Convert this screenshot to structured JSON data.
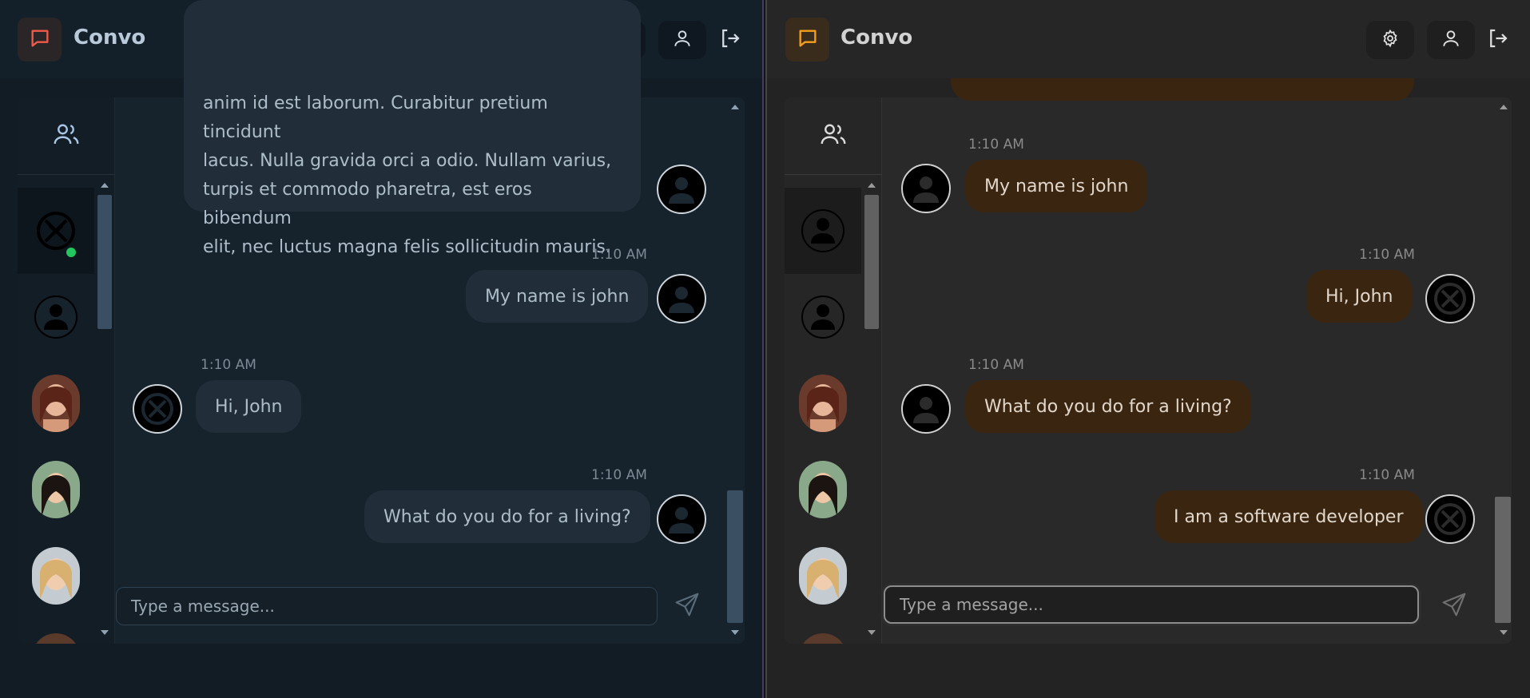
{
  "colors": {
    "online": "#22c55e",
    "accent_left": "#f05a4a",
    "accent_right": "#f59f1a"
  },
  "app": {
    "brand": "Convo"
  },
  "panes": [
    {
      "theme": "dark-blue",
      "messages": [
        {
          "side": "right",
          "type": "long",
          "text_lines": [
            "anim id est laborum. Curabitur pretium tincidunt",
            "lacus. Nulla gravida orci a odio. Nullam varius,",
            "turpis et commodo pharetra, est eros bibendum",
            "elit, nec luctus magna felis sollicitudin mauris."
          ]
        },
        {
          "side": "right",
          "time": "1:10 AM",
          "text": "My name is john"
        },
        {
          "side": "left",
          "time": "1:10 AM",
          "text": "Hi, John"
        },
        {
          "side": "right",
          "time": "1:10 AM",
          "text": "What do you do for a living?"
        }
      ],
      "input_placeholder": "Type a message..."
    },
    {
      "theme": "dark-amber",
      "messages": [
        {
          "side": "left",
          "time": "1:10 AM",
          "text": "My name is john"
        },
        {
          "side": "right",
          "time": "1:10 AM",
          "text": "Hi, John"
        },
        {
          "side": "left",
          "time": "1:10 AM",
          "text": "What do you do for a living?"
        },
        {
          "side": "right",
          "time": "1:10 AM",
          "text": "I am a software developer"
        }
      ],
      "input_placeholder": "Type a message..."
    }
  ],
  "icons": {
    "logo": "chat-bubble-icon",
    "settings": "gear-icon",
    "profile": "user-icon",
    "logout": "logout-icon",
    "contacts": "users-icon",
    "send": "send-icon"
  }
}
